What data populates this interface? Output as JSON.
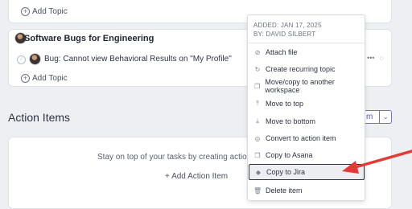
{
  "top_card": {
    "add_topic": "Add Topic"
  },
  "bugs_card": {
    "title": "Software Bugs for Engineering",
    "item_text": "Bug: Cannot view Behavioral Results on \"My Profile\"",
    "add_topic": "Add Topic"
  },
  "action_items": {
    "title": "Action Items",
    "button_label": "m",
    "empty_text": "Stay on top of your tasks by creating action ite",
    "add_action": "+ Add Action Item"
  },
  "menu": {
    "meta_added": "ADDED: JAN 17, 2025",
    "meta_by": "BY: DAVID SILBERT",
    "items": [
      {
        "label": "Attach file",
        "icon": "paperclip-icon"
      },
      {
        "label": "Create recurring topic",
        "icon": "recurring-icon"
      },
      {
        "label": "Move/copy to another workspace",
        "icon": "copy-icon"
      },
      {
        "label": "Move to top",
        "icon": "arrow-to-top-icon"
      },
      {
        "label": "Move to bottom",
        "icon": "arrow-to-bottom-icon"
      },
      {
        "label": "Convert to action item",
        "icon": "check-circle-icon"
      },
      {
        "label": "Copy to Asana",
        "icon": "copy-icon"
      },
      {
        "label": "Copy to Jira",
        "icon": "jira-icon"
      },
      {
        "label": "Delete item",
        "icon": "trash-icon"
      }
    ],
    "selected_index": 7
  },
  "colors": {
    "accent": "#5b4fc7",
    "annotation_arrow": "#e53935"
  }
}
